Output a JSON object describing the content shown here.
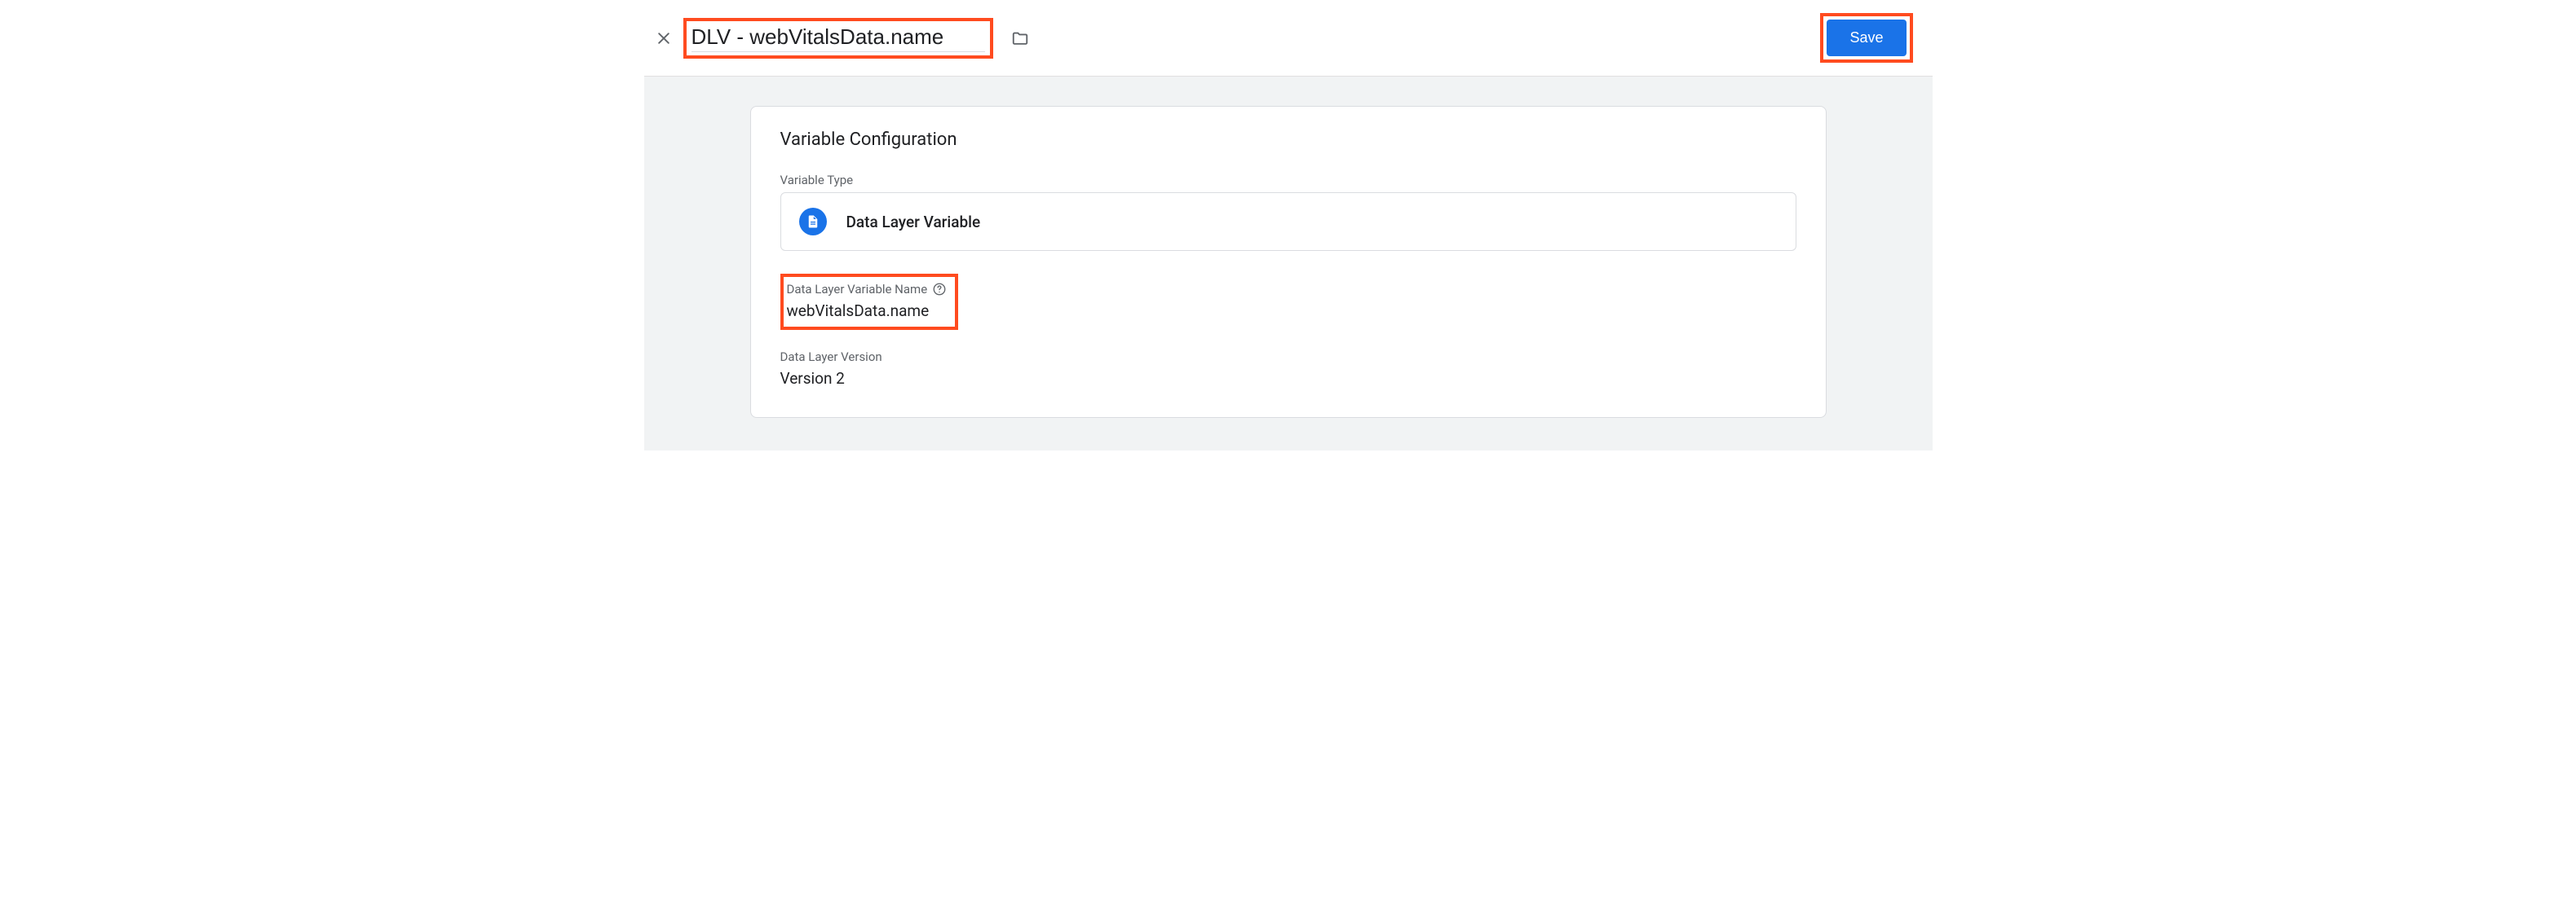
{
  "header": {
    "variable_name": "DLV - webVitalsData.name",
    "save_label": "Save"
  },
  "config": {
    "section_title": "Variable Configuration",
    "type_label": "Variable Type",
    "type_value": "Data Layer Variable",
    "dlv_name_label": "Data Layer Variable Name",
    "dlv_name_value": "webVitalsData.name",
    "version_label": "Data Layer Version",
    "version_value": "Version 2"
  }
}
